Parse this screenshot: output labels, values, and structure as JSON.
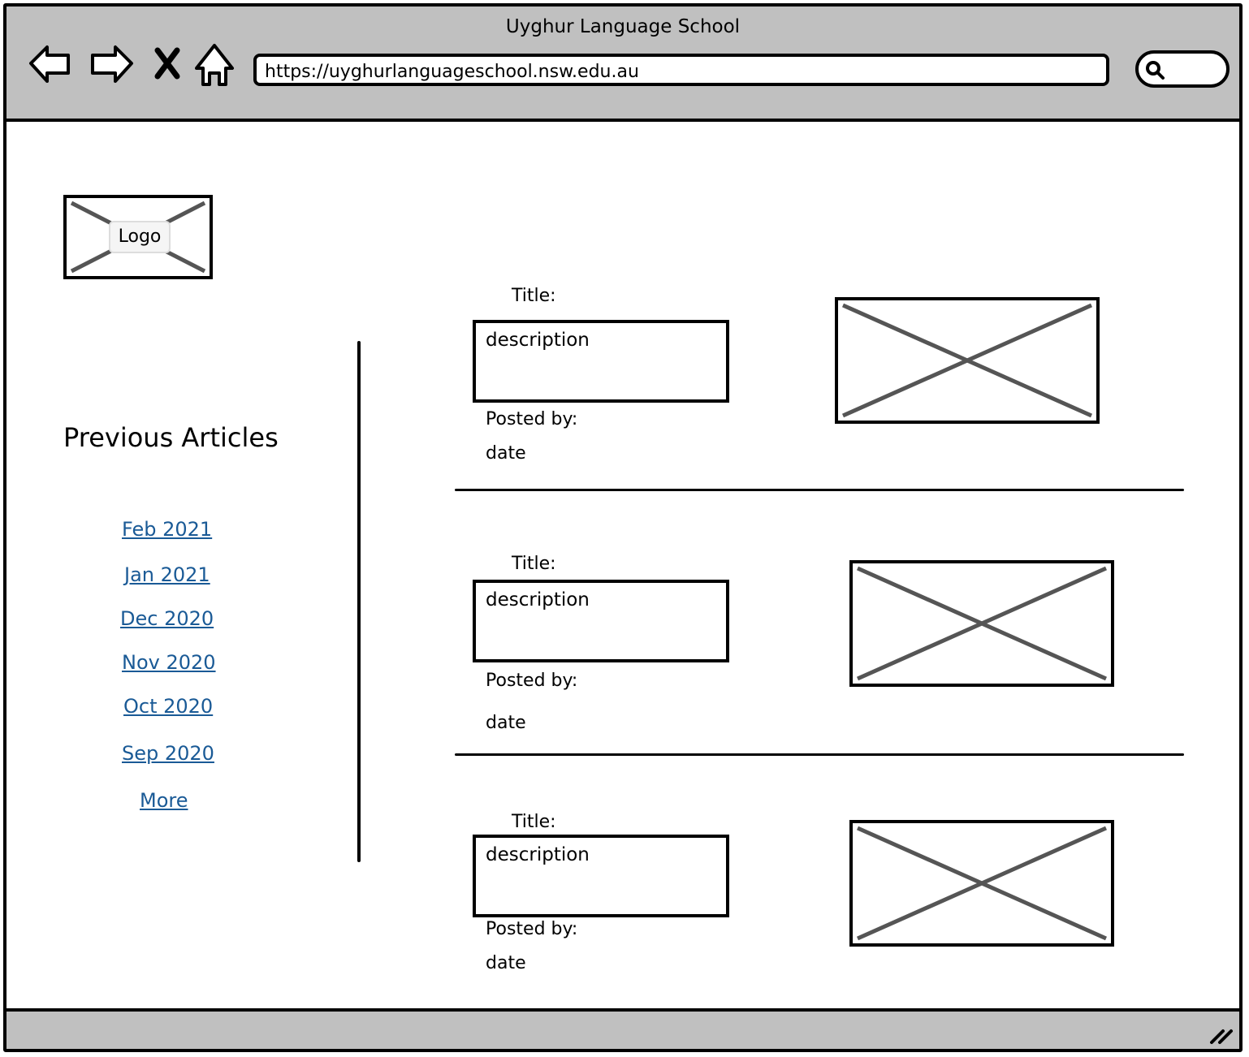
{
  "browser": {
    "window_title": "Uyghur Language School",
    "url": "https://uyghurlanguageschool.nsw.edu.au",
    "nav_icons": [
      "back-arrow-icon",
      "forward-arrow-icon",
      "stop-icon",
      "home-icon"
    ],
    "search_icon": "search-icon"
  },
  "sidebar": {
    "logo_label": "Logo",
    "heading": "Previous Articles",
    "archive_links": [
      "Feb 2021",
      "Jan 2021",
      "Dec 2020",
      "Nov 2020",
      "Oct 2020",
      "Sep 2020",
      "More"
    ]
  },
  "articles": [
    {
      "title": "Title:",
      "description": "description",
      "posted_by": "Posted by:",
      "date": "date"
    },
    {
      "title": "Title:",
      "description": "description",
      "posted_by": "Posted by:",
      "date": "date"
    },
    {
      "title": "Title:",
      "description": "description",
      "posted_by": "Posted by:",
      "date": "date"
    }
  ],
  "colors": {
    "chrome": "#c0c0c0",
    "link": "#1a5a96",
    "placeholder_x": "#555555"
  }
}
